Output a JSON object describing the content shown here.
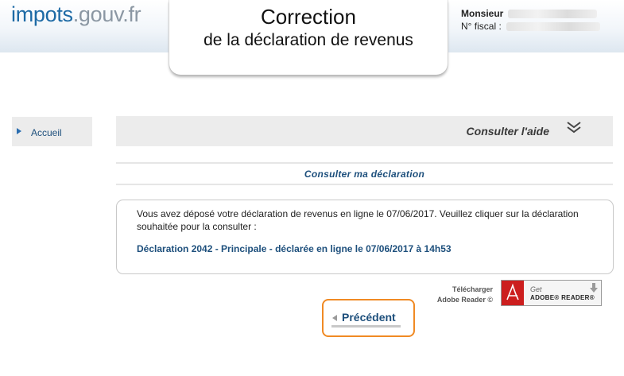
{
  "header": {
    "logo_part1": "impots",
    "logo_part2": ".gouv.fr",
    "title_line1": "Correction",
    "title_line2": "de la déclaration de revenus",
    "user_label": "Monsieur",
    "fiscal_label": "N° fiscal :"
  },
  "sidebar": {
    "items": [
      {
        "label": "Accueil",
        "icon": "triangle-right-icon"
      }
    ]
  },
  "help": {
    "label": "Consulter l'aide",
    "icon": "double-chevron-down-icon"
  },
  "section": {
    "title": "Consulter ma déclaration"
  },
  "info": {
    "text": "Vous avez déposé votre déclaration de revenus en ligne le 07/06/2017. Veuillez cliquer sur la déclaration souhaitée pour la consulter :",
    "declaration_link": "Déclaration 2042 - Principale - déclarée en ligne le 07/06/2017 à 14h53"
  },
  "adobe": {
    "download_line1": "Télécharger",
    "download_line2": "Adobe Reader ©",
    "badge_get": "Get",
    "badge_name": "ADOBE® READER®"
  },
  "navigation": {
    "previous_label": "Précédent"
  },
  "colors": {
    "link_blue": "#1d4f7c",
    "logo_blue": "#1d6aa5",
    "button_border": "#f08a24"
  }
}
